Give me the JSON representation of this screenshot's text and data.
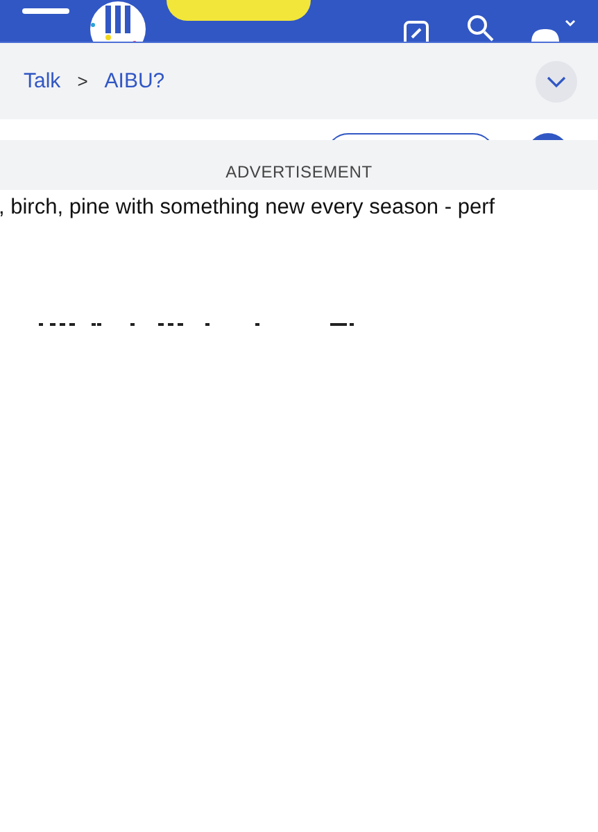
{
  "breadcrumb": [
    {
      "label": "Talk"
    },
    {
      "label": "AIBU?"
    }
  ],
  "breadcrumb_separator": ">",
  "ad_label": "ADVERTISEMENT",
  "ad_text": ", birch, pine with something new every season - perf"
}
